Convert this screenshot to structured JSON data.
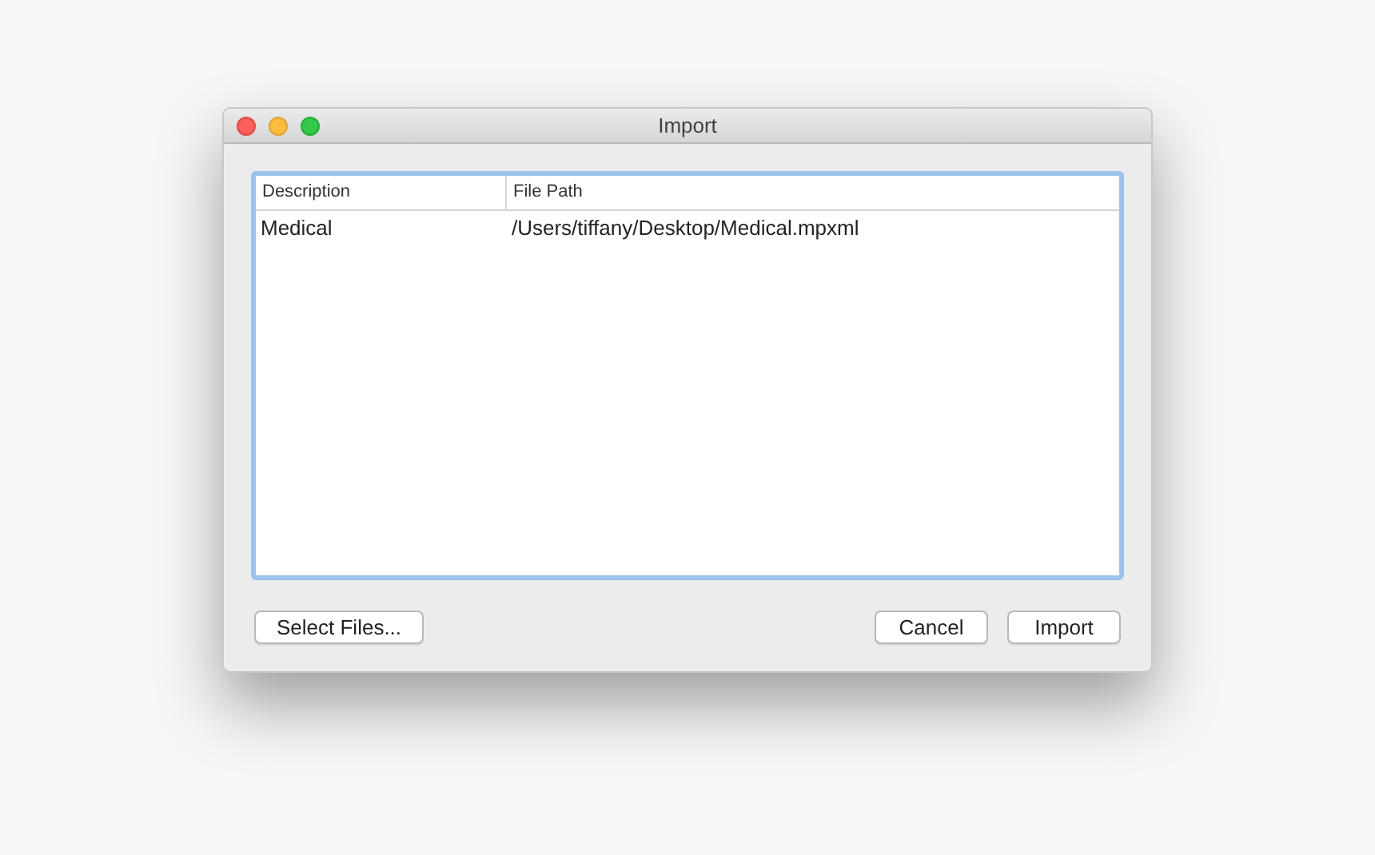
{
  "window": {
    "title": "Import"
  },
  "table": {
    "columns": [
      "Description",
      "File Path"
    ],
    "rows": [
      [
        "Medical",
        "/Users/tiffany/Desktop/Medical.mpxml"
      ]
    ]
  },
  "buttons": {
    "left": [
      "Select Files..."
    ],
    "right": [
      "Cancel",
      "Import"
    ]
  }
}
